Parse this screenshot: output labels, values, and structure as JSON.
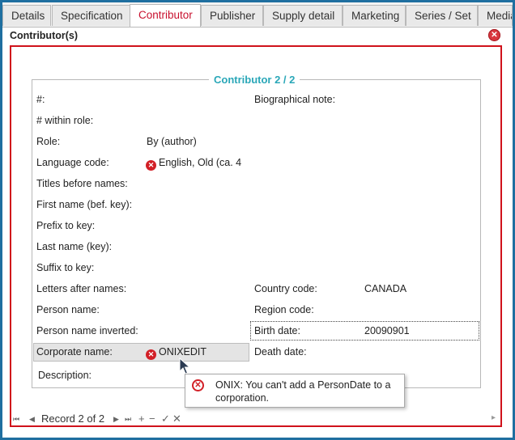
{
  "tabs": [
    {
      "label": "Details"
    },
    {
      "label": "Specification"
    },
    {
      "label": "Contributor"
    },
    {
      "label": "Publisher"
    },
    {
      "label": "Supply detail"
    },
    {
      "label": "Marketing"
    },
    {
      "label": "Series / Set"
    },
    {
      "label": "Media"
    }
  ],
  "active_tab": "Contributor",
  "section": {
    "title": "Contributor(s)",
    "close_icon": "close-circle-icon"
  },
  "record": {
    "legend": "Contributor 2 / 2"
  },
  "left_fields": [
    {
      "label": "#:",
      "value": ""
    },
    {
      "label": "# within role:",
      "value": ""
    },
    {
      "label": "Role:",
      "value": "By (author)"
    },
    {
      "label": "Language code:",
      "value": "English, Old (ca. 4",
      "error": true
    },
    {
      "label": "Titles before names:",
      "value": ""
    },
    {
      "label": "First name (bef. key):",
      "value": ""
    },
    {
      "label": "Prefix to key:",
      "value": ""
    },
    {
      "label": "Last name (key):",
      "value": ""
    },
    {
      "label": "Suffix to key:",
      "value": ""
    },
    {
      "label": "Letters after names:",
      "value": ""
    },
    {
      "label": "Person name:",
      "value": ""
    },
    {
      "label": "Person name inverted:",
      "value": ""
    },
    {
      "label": "Corporate name:",
      "value": "ONIXEDIT",
      "error": true
    },
    {
      "label": "Description:",
      "value": ""
    }
  ],
  "right_fields": [
    {
      "label": "Biographical note:",
      "value": ""
    },
    {
      "label": "Country code:",
      "value": "CANADA"
    },
    {
      "label": "Region code:",
      "value": ""
    },
    {
      "label": "Birth date:",
      "value": "20090901"
    },
    {
      "label": "Death date:",
      "value": ""
    }
  ],
  "tooltip": {
    "text": "ONIX: You can't add a PersonDate to a corporation.",
    "icon": "error-icon"
  },
  "navigation": {
    "record_text": "Record 2 of 2",
    "first": "⏮",
    "prev": "◀",
    "next": "▶",
    "last": "⏭",
    "add": "+",
    "remove": "−",
    "confirm": "✓",
    "cancel": "✕"
  },
  "colors": {
    "accent_red": "#d0121b",
    "legend_teal": "#2aa7b8",
    "window_blue": "#1f6fa0"
  }
}
